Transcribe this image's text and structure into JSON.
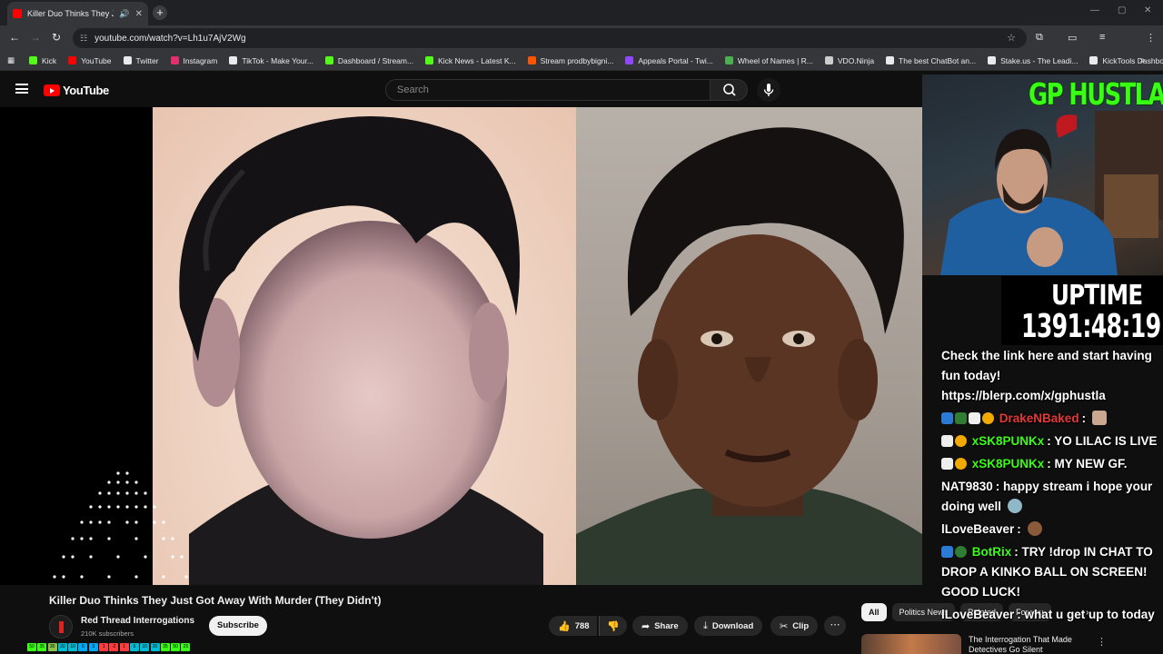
{
  "browser": {
    "tab_title": "Killer Duo Thinks They Just",
    "url": "youtube.com/watch?v=Lh1u7AjV2Wg",
    "bookmarks": [
      {
        "label": "Kick",
        "color": "#53fc18"
      },
      {
        "label": "YouTube",
        "color": "#ff0000"
      },
      {
        "label": "Twitter",
        "color": "#e8eaed"
      },
      {
        "label": "Instagram",
        "color": "#e1306c"
      },
      {
        "label": "TikTok - Make Your...",
        "color": "#e8eaed"
      },
      {
        "label": "Dashboard / Stream...",
        "color": "#53fc18"
      },
      {
        "label": "Kick News - Latest K...",
        "color": "#53fc18"
      },
      {
        "label": "Stream prodbybigni...",
        "color": "#ff5500"
      },
      {
        "label": "Appeals Portal - Twi...",
        "color": "#9146ff"
      },
      {
        "label": "Wheel of Names | R...",
        "color": "#4caf50"
      },
      {
        "label": "VDO.Ninja",
        "color": "#cccccc"
      },
      {
        "label": "The best ChatBot an...",
        "color": "#e8eaed"
      },
      {
        "label": "Stake.us - The Leadi...",
        "color": "#e8eaed"
      },
      {
        "label": "KickTools Dashboard",
        "color": "#e8eaed"
      }
    ]
  },
  "youtube": {
    "logo_text": "YouTube",
    "search_placeholder": "Search",
    "video_title": "Killer Duo Thinks They Just Got Away With Murder (They Didn't)",
    "channel_name": "Red Thread Interrogations",
    "subscribers": "210K subscribers",
    "subscribe_label": "Subscribe",
    "likes": "788",
    "share_label": "Share",
    "download_label": "Download",
    "clip_label": "Clip",
    "chips": [
      "All",
      "Politics News",
      "Related",
      "For you"
    ],
    "related_title_lines": [
      "The Interrogation That Made",
      "Detectives Go Silent"
    ]
  },
  "stream": {
    "cam_title": "GP HUSTLA",
    "uptime_label": "UPTIME",
    "uptime_value": "1391:48:19",
    "chat": [
      {
        "user": "",
        "text": "Check the link here and start having fun today! https://blerp.com/x/gphustla",
        "color": "#ffffff"
      },
      {
        "user": "DrakeNBaked",
        "text": ":",
        "color": "#e53935"
      },
      {
        "user": "xSK8PUNKx",
        "text": ": YO LILAC IS LIVE",
        "color": "#39ff14"
      },
      {
        "user": "xSK8PUNKx",
        "text": ": MY NEW GF.",
        "color": "#39ff14"
      },
      {
        "user": "NAT9830",
        "text": ": happy stream i hope your doing well",
        "color": "#ffffff"
      },
      {
        "user": "lLoveBeaver",
        "text": ":",
        "color": "#ffffff"
      },
      {
        "user": "BotRix",
        "text": ": TRY !drop IN CHAT TO DROP A KINKO BALL ON SCREEN! GOOD LUCK!",
        "color": "#39ff14"
      },
      {
        "user": "lLoveBeaver",
        "text": ": what u get up to today",
        "color": "#ffffff"
      }
    ],
    "emote_row": [
      "50",
      "35",
      "30",
      "20",
      "10",
      "5",
      "3",
      "1",
      "-2",
      "1",
      "5",
      "10",
      "20",
      "35",
      "50",
      "25"
    ]
  }
}
